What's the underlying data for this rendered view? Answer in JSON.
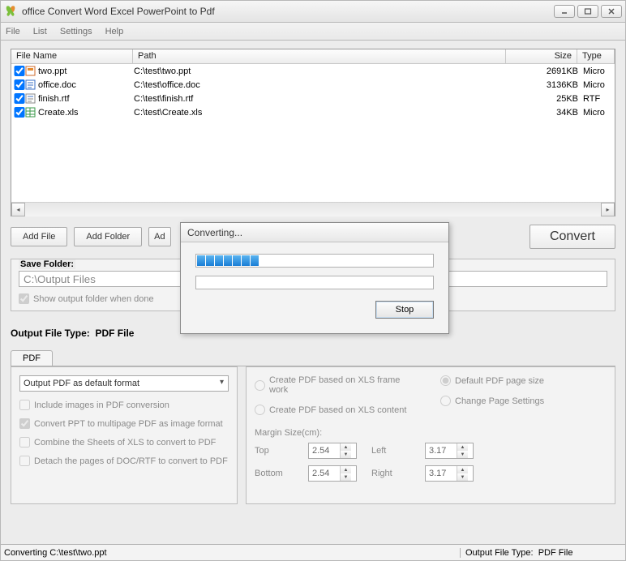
{
  "window": {
    "title": "office Convert Word Excel PowerPoint to Pdf"
  },
  "menu": {
    "file": "File",
    "list": "List",
    "settings": "Settings",
    "help": "Help"
  },
  "table": {
    "headers": {
      "filename": "File Name",
      "path": "Path",
      "size": "Size",
      "type": "Type"
    },
    "rows": [
      {
        "name": "two.ppt",
        "path": "C:\\test\\two.ppt",
        "size": "2691KB",
        "type": "Micro"
      },
      {
        "name": "office.doc",
        "path": "C:\\test\\office.doc",
        "size": "3136KB",
        "type": "Micro"
      },
      {
        "name": "finish.rtf",
        "path": "C:\\test\\finish.rtf",
        "size": "25KB",
        "type": "RTF"
      },
      {
        "name": "Create.xls",
        "path": "C:\\test\\Create.xls",
        "size": "34KB",
        "type": "Micro"
      }
    ]
  },
  "buttons": {
    "add_file": "Add File",
    "add_folder": "Add Folder",
    "add_partial": "Ad",
    "convert": "Convert"
  },
  "save": {
    "legend": "Save Folder:",
    "path": "C:\\Output Files",
    "show_output": "Show output folder when done"
  },
  "output_type": {
    "label_prefix": "Output File Type:",
    "label_value": "PDF File",
    "tab": "PDF"
  },
  "pdf_opts": {
    "format_select": "Output PDF as default format",
    "include_images": "Include images in PDF conversion",
    "convert_ppt": "Convert PPT to multipage PDF as image format",
    "combine_xls": "Combine the Sheets of XLS to convert to PDF",
    "detach_doc": "Detach the pages of DOC/RTF to convert to PDF"
  },
  "xls_opts": {
    "frame": "Create PDF based on XLS frame work",
    "content": "Create PDF based on XLS content",
    "default_size": "Default PDF page size",
    "change_page": "Change Page Settings",
    "margin_label": "Margin Size(cm):",
    "top": "Top",
    "bottom": "Bottom",
    "left": "Left",
    "right": "Right",
    "v_top": "2.54",
    "v_bottom": "2.54",
    "v_left": "3.17",
    "v_right": "3.17"
  },
  "status": {
    "left": "Converting  C:\\test\\two.ppt",
    "right_prefix": "Output File Type:",
    "right_value": "PDF File"
  },
  "dialog": {
    "title": "Converting...",
    "stop": "Stop"
  }
}
